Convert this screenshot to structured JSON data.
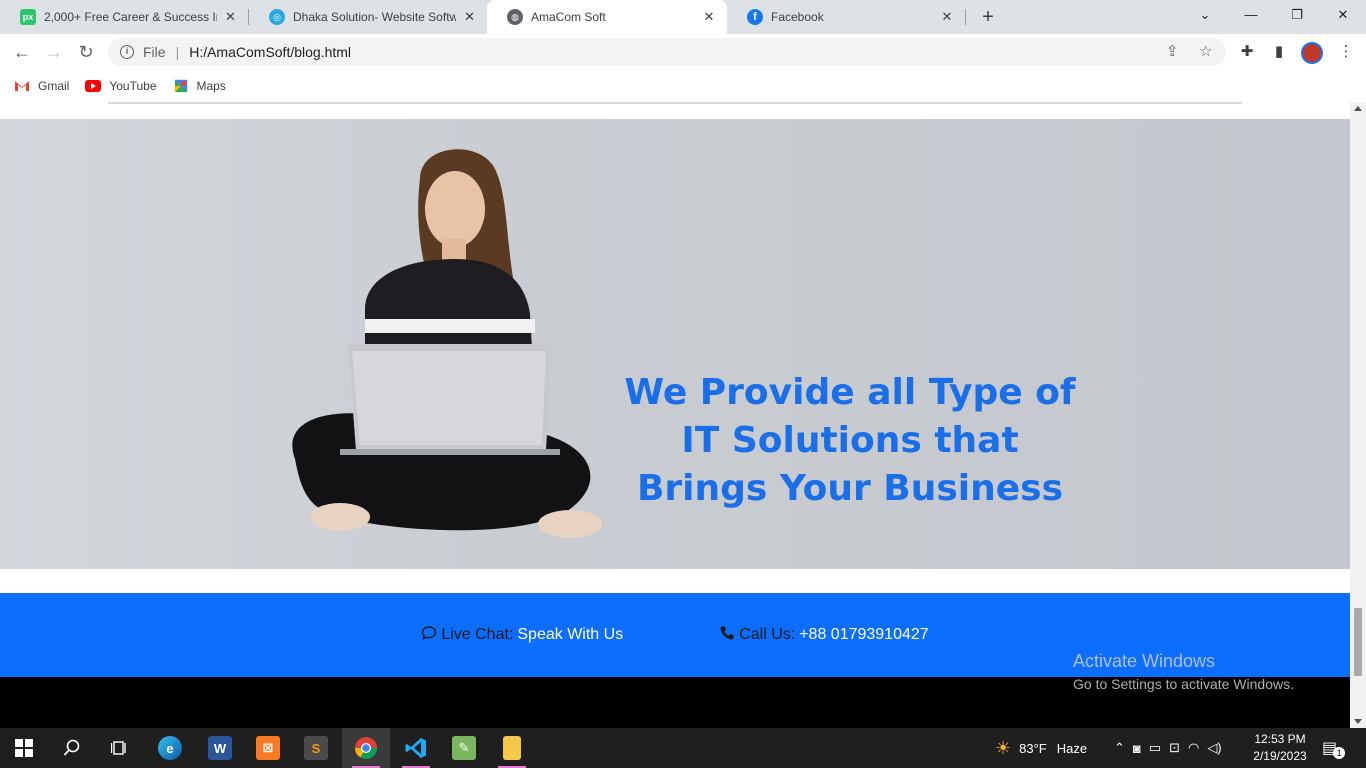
{
  "browser": {
    "tabs": [
      {
        "title": "2,000+ Free Career & Success Im",
        "favicon": "pixabay-icon",
        "active": false
      },
      {
        "title": "Dhaka Solution- Website Softwar",
        "favicon": "globe-icon",
        "active": false
      },
      {
        "title": "AmaCom Soft",
        "favicon": "globe-icon",
        "active": true
      },
      {
        "title": "Facebook",
        "favicon": "facebook-icon",
        "active": false
      }
    ],
    "address": {
      "scheme": "File",
      "url": "H:/AmaComSoft/blog.html"
    },
    "bookmarks": [
      {
        "label": "Gmail",
        "icon": "gmail-icon"
      },
      {
        "label": "YouTube",
        "icon": "youtube-icon"
      },
      {
        "label": "Maps",
        "icon": "maps-icon"
      }
    ]
  },
  "page": {
    "hero": {
      "headline": [
        "We Provide all Type of",
        "IT Solutions that",
        "Brings Your Business"
      ],
      "accent_color": "#1a6fe8"
    },
    "contact": {
      "chat_label": "Live Chat:",
      "chat_value": "Speak With Us",
      "call_label": "Call Us:",
      "call_value": "+88 01793910427",
      "bar_color": "#0d6efd"
    },
    "watermark": {
      "line1": "Activate Windows",
      "line2": "Go to Settings to activate Windows."
    }
  },
  "taskbar": {
    "weather": {
      "temp": "83°F",
      "condition": "Haze"
    },
    "clock": {
      "time": "12:53 PM",
      "date": "2/19/2023"
    },
    "notifications": "1"
  }
}
